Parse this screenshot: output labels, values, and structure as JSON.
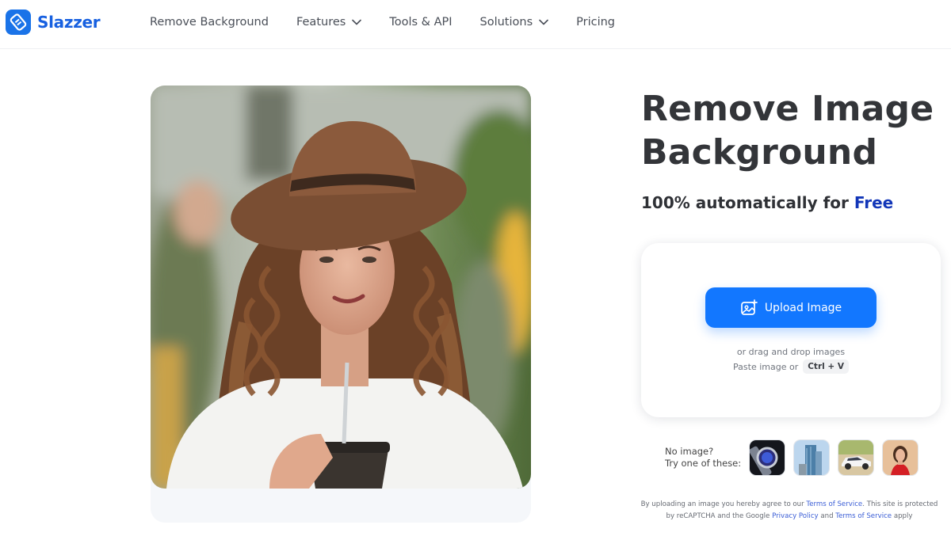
{
  "brand": {
    "name": "Slazzer",
    "accent": "#1a73e8"
  },
  "nav": {
    "items": [
      {
        "label": "Remove Background",
        "has_dropdown": false
      },
      {
        "label": "Features",
        "has_dropdown": true
      },
      {
        "label": "Tools & API",
        "has_dropdown": false
      },
      {
        "label": "Solutions",
        "has_dropdown": true
      },
      {
        "label": "Pricing",
        "has_dropdown": false
      }
    ]
  },
  "hero": {
    "headline_line1": "Remove Image",
    "headline_line2": "Background",
    "subheadline_prefix": "100% automatically for ",
    "subheadline_highlight": "Free",
    "highlight_color": "#1236b8"
  },
  "upload": {
    "button_label": "Upload Image",
    "button_icon": "image-plus-icon",
    "button_color": "#1277ff",
    "drag_text": "or drag and drop images",
    "paste_text": "Paste image or",
    "shortcut": "Ctrl + V"
  },
  "samples": {
    "label_line1": "No image?",
    "label_line2": "Try one of these:",
    "items": [
      {
        "name": "smartwatch"
      },
      {
        "name": "skyscraper"
      },
      {
        "name": "car"
      },
      {
        "name": "woman-in-red"
      }
    ]
  },
  "legal": {
    "part1": "By uploading an image you hereby agree to our ",
    "terms1": "Terms of Service",
    "part2": ". This site is protected by reCAPTCHA and the Google ",
    "privacy": "Privacy Policy",
    "part3": " and ",
    "terms2": "Terms of Service",
    "part4": " apply"
  }
}
